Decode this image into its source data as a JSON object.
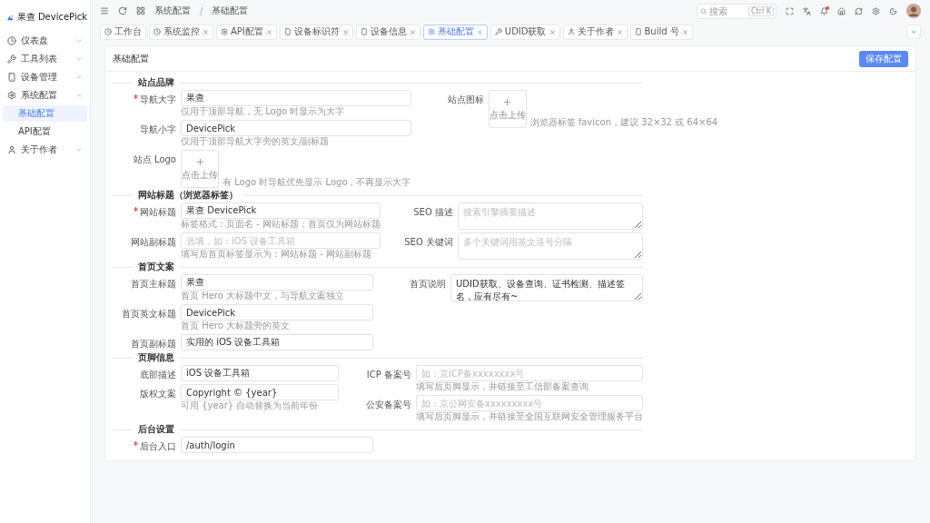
{
  "brand": {
    "name": "果查 DevicePick"
  },
  "sidebar": {
    "items": [
      {
        "kind": "dashboard",
        "label": "仪表盘",
        "expanded": false
      },
      {
        "kind": "tools",
        "label": "工具列表",
        "expanded": false
      },
      {
        "kind": "device",
        "label": "设备管理",
        "expanded": false
      },
      {
        "kind": "settings",
        "label": "系统配置",
        "expanded": true,
        "children": [
          {
            "label": "基础配置",
            "selected": true
          },
          {
            "label": "API配置",
            "selected": false
          }
        ]
      },
      {
        "kind": "user",
        "label": "关于作者",
        "expanded": false
      }
    ]
  },
  "topbar": {
    "breadcrumbs": [
      "系统配置",
      "基础配置"
    ],
    "breadcrumb_separator": "/",
    "search": {
      "placeholder": "搜索",
      "shortcut": "Ctrl K"
    },
    "notifications_unread": true
  },
  "tabs": [
    {
      "kind": "dashboard",
      "label": "工作台",
      "closable": false,
      "selected": false
    },
    {
      "kind": "dashboard",
      "label": "系统监控",
      "closable": true,
      "selected": false
    },
    {
      "kind": "settings",
      "label": "API配置",
      "closable": true,
      "selected": false
    },
    {
      "kind": "device",
      "label": "设备标识符",
      "closable": true,
      "selected": false
    },
    {
      "kind": "device",
      "label": "设备信息",
      "closable": true,
      "selected": false
    },
    {
      "kind": "settings",
      "label": "基础配置",
      "closable": true,
      "selected": true
    },
    {
      "kind": "tools",
      "label": "UDID获取",
      "closable": true,
      "selected": false
    },
    {
      "kind": "user",
      "label": "关于作者",
      "closable": true,
      "selected": false
    },
    {
      "kind": "device",
      "label": "Build 号",
      "closable": true,
      "selected": false
    }
  ],
  "card": {
    "title": "基础配置",
    "save_button": "保存配置"
  },
  "sections": [
    {
      "title": "站点品牌",
      "left": [
        {
          "kind": "input",
          "label": "导航大字",
          "required": true,
          "value": "果查",
          "hint": "仅用于顶部导航，无 Logo 时显示为大字"
        },
        {
          "kind": "input",
          "label": "导航小字",
          "required": false,
          "value": "DevicePick",
          "hint": "仅用于顶部导航大字旁的英文/副标题"
        },
        {
          "kind": "upload",
          "label": "站点 Logo",
          "required": false,
          "button_text": "点击上传",
          "hint": "有 Logo 时导航优先显示 Logo，不再显示大字"
        }
      ],
      "right": [
        {
          "kind": "upload",
          "label": "站点图标",
          "required": false,
          "button_text": "点击上传",
          "hint": "浏览器标签 favicon，建议 32×32 或 64×64"
        }
      ]
    },
    {
      "title": "网站标题（浏览器标签）",
      "left": [
        {
          "kind": "input",
          "label": "网站标题",
          "required": true,
          "value": "果查 DevicePick",
          "hint": "标签格式：页面名 - 网站标题；首页仅为网站标题"
        },
        {
          "kind": "input",
          "label": "网站副标题",
          "required": false,
          "placeholder": "选填，如：iOS 设备工具箱",
          "hint": "填写后首页标签显示为：网站标题 - 网站副标题"
        }
      ],
      "right": [
        {
          "kind": "textarea",
          "label": "SEO 描述",
          "required": false,
          "placeholder": "搜索引擎摘要描述"
        },
        {
          "kind": "textarea",
          "label": "SEO 关键词",
          "required": false,
          "placeholder": "多个关键词用英文逗号分隔"
        }
      ]
    },
    {
      "title": "首页文案",
      "left": [
        {
          "kind": "input",
          "label": "首页主标题",
          "required": false,
          "value": "果查",
          "hint": "首页 Hero 大标题中文，与导航文案独立"
        },
        {
          "kind": "input",
          "label": "首页英文标题",
          "required": false,
          "value": "DevicePick",
          "hint": "首页 Hero 大标题旁的英文"
        },
        {
          "kind": "input",
          "label": "首页副标题",
          "required": false,
          "value": "实用的 iOS 设备工具箱"
        }
      ],
      "right": [
        {
          "kind": "textarea",
          "label": "首页说明",
          "required": false,
          "value": "UDID获取、设备查询、证书检测、描述签名，应有尽有~"
        }
      ]
    },
    {
      "title": "页脚信息",
      "left": [
        {
          "kind": "input",
          "label": "底部描述",
          "required": false,
          "value": "iOS 设备工具箱"
        },
        {
          "kind": "input",
          "label": "版权文案",
          "required": false,
          "value": "Copyright © {year}",
          "hint": "可用 {year} 自动替换为当前年份"
        }
      ],
      "right": [
        {
          "kind": "input",
          "label": "ICP 备案号",
          "required": false,
          "placeholder": "如：京ICP备xxxxxxxx号",
          "hint": "填写后页脚显示，并链接至工信部备案查询"
        },
        {
          "kind": "input",
          "label": "公安备案号",
          "required": false,
          "placeholder": "如：京公网安备xxxxxxxxx号",
          "hint": "填写后页脚显示，并链接至全国互联网安全管理服务平台"
        }
      ]
    },
    {
      "title": "后台设置",
      "left": [
        {
          "kind": "input",
          "label": "后台入口",
          "required": true,
          "value": "/auth/login"
        }
      ]
    }
  ]
}
